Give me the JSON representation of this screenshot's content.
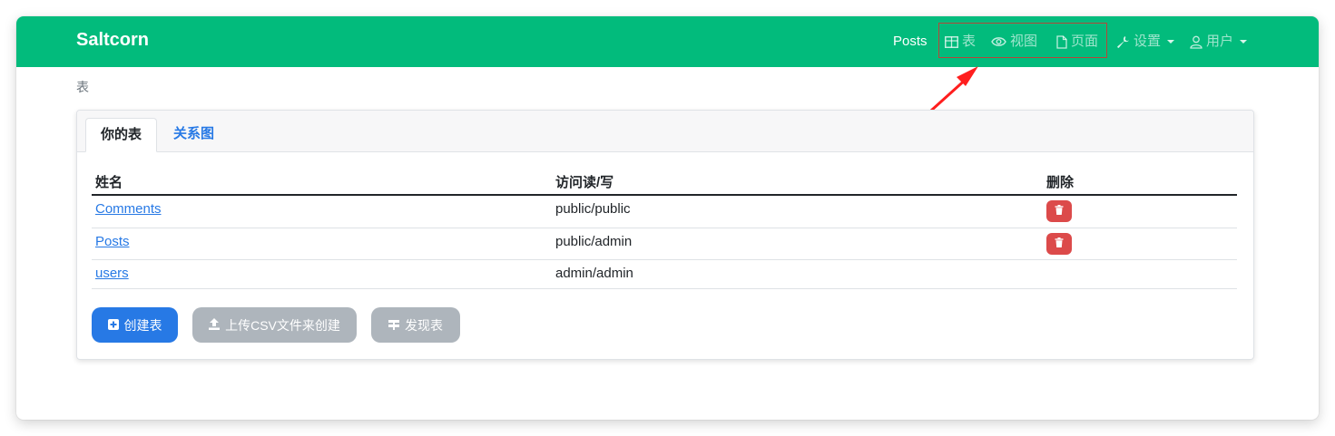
{
  "navbar": {
    "brand": "Saltcorn",
    "items": [
      {
        "label": "Posts",
        "icon": ""
      },
      {
        "label": "表",
        "icon": "table-icon"
      },
      {
        "label": "视图",
        "icon": "eye-icon"
      },
      {
        "label": "页面",
        "icon": "file-icon"
      },
      {
        "label": "设置",
        "icon": "wrench-icon"
      },
      {
        "label": "用户",
        "icon": "user-icon"
      }
    ],
    "color": "#02bb7c"
  },
  "breadcrumb": "表",
  "tabs": [
    {
      "label": "你的表"
    },
    {
      "label": "关系图"
    }
  ],
  "table": {
    "headers": [
      "姓名",
      "访问读/写",
      "删除"
    ],
    "rows": [
      {
        "name": "Comments",
        "access": "public/public",
        "deletable": true
      },
      {
        "name": "Posts",
        "access": "public/admin",
        "deletable": true
      },
      {
        "name": "users",
        "access": "admin/admin",
        "deletable": false
      }
    ]
  },
  "buttons": {
    "create": "创建表",
    "upload": "上传CSV文件来创建",
    "discover": "发现表"
  },
  "colors": {
    "primary": "#2779e5",
    "danger": "#dc4a4a",
    "secondary": "#aeb5bc",
    "annotation": "#ff1e1e"
  }
}
